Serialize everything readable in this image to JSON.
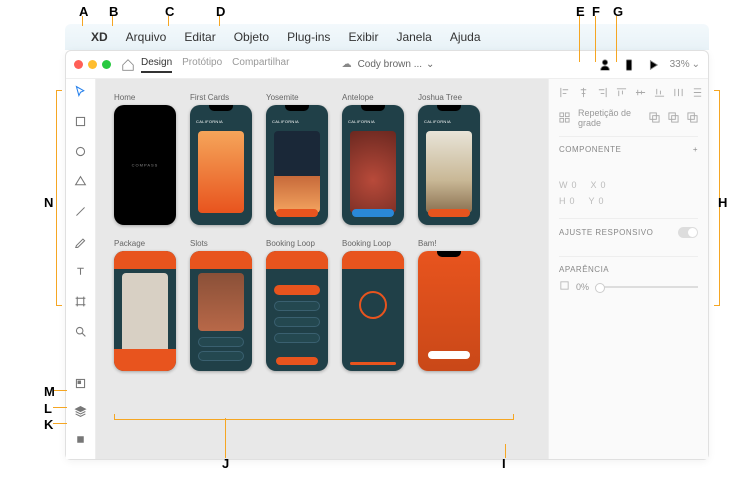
{
  "annotations": {
    "A": "A",
    "B": "B",
    "C": "C",
    "D": "D",
    "E": "E",
    "F": "F",
    "G": "G",
    "H": "H",
    "I": "I",
    "J": "J",
    "K": "K",
    "L": "L",
    "M": "M",
    "N": "N"
  },
  "menubar": {
    "xd": "XD",
    "arquivo": "Arquivo",
    "editar": "Editar",
    "objeto": "Objeto",
    "plugins": "Plug-ins",
    "exibir": "Exibir",
    "janela": "Janela",
    "ajuda": "Ajuda"
  },
  "tabs": {
    "design": "Design",
    "prototipo": "Protótipo",
    "compartilhar": "Compartilhar"
  },
  "doc": {
    "title": "Cody brown ...",
    "dropdown": "⌄"
  },
  "zoom": {
    "value": "33%",
    "caret": "⌄"
  },
  "artboards": {
    "row1": [
      {
        "label": "Home"
      },
      {
        "label": "First Cards",
        "tag": "CALIFORNIA"
      },
      {
        "label": "Yosemite",
        "tag": "CALIFORNIA"
      },
      {
        "label": "Antelope",
        "tag": "CALIFORNIA"
      },
      {
        "label": "Joshua Tree",
        "tag": "CALIFORNIA"
      }
    ],
    "row2": [
      {
        "label": "Package"
      },
      {
        "label": "Slots"
      },
      {
        "label": "Booking Loop"
      },
      {
        "label": "Booking Loop"
      },
      {
        "label": "Bam!"
      }
    ]
  },
  "props": {
    "repeat": "Repetição de grade",
    "componente": "COMPONENTE",
    "w": "W",
    "h": "H",
    "x": "X",
    "y": "Y",
    "zero": "0",
    "responsivo": "AJUSTE RESPONSIVO",
    "aparencia": "APARÊNCIA",
    "opacity": "0%"
  },
  "brand": {
    "compass": "COMPASS"
  }
}
